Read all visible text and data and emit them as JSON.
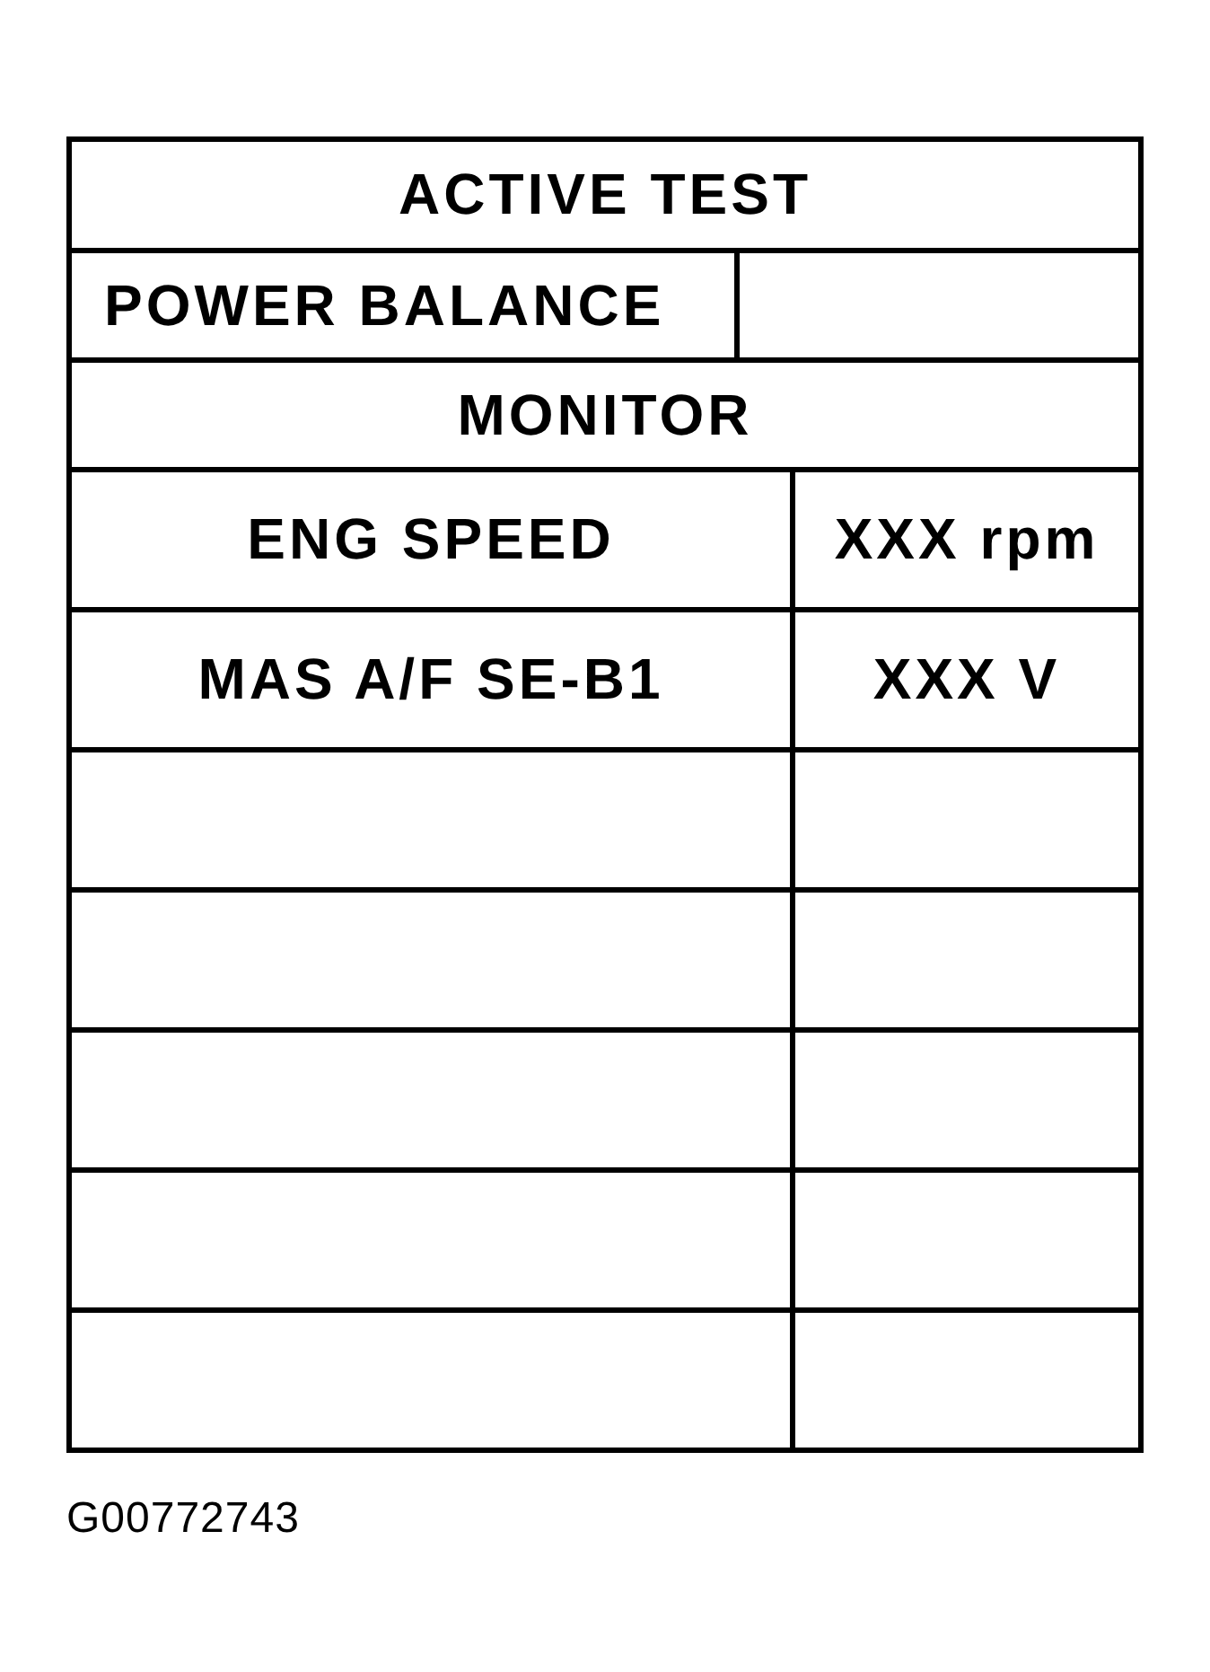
{
  "table": {
    "title": "ACTIVE TEST",
    "test_row": {
      "label": "POWER BALANCE"
    },
    "section": "MONITOR",
    "rows": [
      {
        "item": "ENG SPEED",
        "value": "XXX rpm"
      },
      {
        "item": "MAS A/F SE-B1",
        "value": "XXX V"
      },
      {},
      {},
      {},
      {},
      {}
    ]
  },
  "caption": "G00772743"
}
